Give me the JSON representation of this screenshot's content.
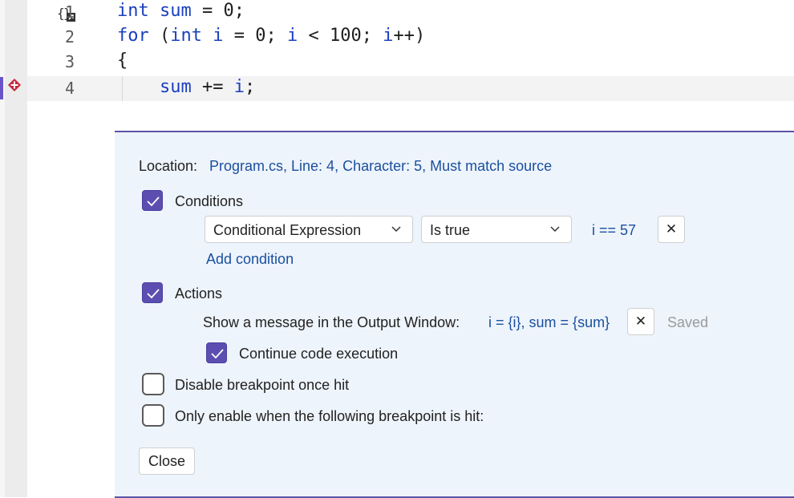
{
  "editor": {
    "lines": [
      {
        "num": "1",
        "parts": [
          {
            "t": "int",
            "c": "kw"
          },
          {
            "t": " ",
            "c": ""
          },
          {
            "t": "sum",
            "c": "var"
          },
          {
            "t": " = 0;",
            "c": ""
          }
        ]
      },
      {
        "num": "2",
        "parts": [
          {
            "t": "for",
            "c": "kw"
          },
          {
            "t": " (",
            "c": ""
          },
          {
            "t": "int",
            "c": "kw"
          },
          {
            "t": " ",
            "c": ""
          },
          {
            "t": "i",
            "c": "var"
          },
          {
            "t": " = 0; ",
            "c": ""
          },
          {
            "t": "i",
            "c": "var"
          },
          {
            "t": " < 100; ",
            "c": ""
          },
          {
            "t": "i",
            "c": "var"
          },
          {
            "t": "++)",
            "c": ""
          }
        ]
      },
      {
        "num": "3",
        "parts": [
          {
            "t": "{",
            "c": ""
          }
        ]
      },
      {
        "num": "4",
        "parts": [
          {
            "t": "    ",
            "c": ""
          },
          {
            "t": "sum",
            "c": "var"
          },
          {
            "t": " += ",
            "c": ""
          },
          {
            "t": "i",
            "c": "var"
          },
          {
            "t": ";",
            "c": ""
          }
        ]
      }
    ],
    "breakpoint_line": "4"
  },
  "settings": {
    "location_label": "Location:",
    "location_value": "Program.cs, Line: 4, Character: 5, Must match source",
    "conditions": {
      "label": "Conditions",
      "checked": true,
      "type_value": "Conditional Expression",
      "operator_value": "Is true",
      "expression": "i == 57",
      "remove_label": "✕",
      "add_label": "Add condition"
    },
    "actions": {
      "label": "Actions",
      "checked": true,
      "message_label": "Show a message in the Output Window:",
      "message_value": "i = {i}, sum = {sum}",
      "remove_label": "✕",
      "status": "Saved",
      "continue_label": "Continue code execution",
      "continue_checked": true
    },
    "disable_once_hit": {
      "label": "Disable breakpoint once hit",
      "checked": false
    },
    "dependent": {
      "label": "Only enable when the following breakpoint is hit:",
      "checked": false
    },
    "close_label": "Close"
  },
  "colors": {
    "accent": "#5b4eb0",
    "panel_bg": "#eef4fb",
    "link": "#1a4f9f",
    "keyword": "#1a3fbf",
    "breakpoint": "#c8283c"
  },
  "icons": {
    "scope": "code-scope-icon",
    "breakpoint": "conditional-breakpoint-icon",
    "check": "checkmark-icon",
    "chevron": "chevron-down-icon",
    "close": "close-icon"
  }
}
